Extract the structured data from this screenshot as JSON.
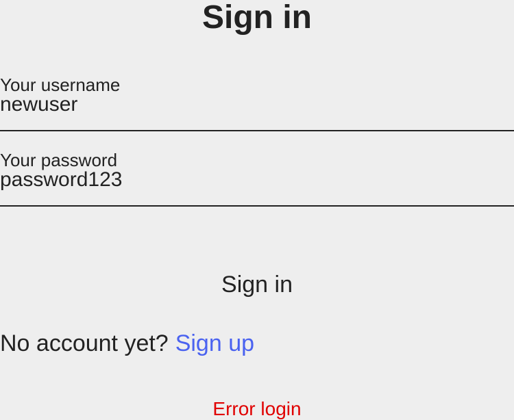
{
  "page": {
    "title": "Sign in"
  },
  "form": {
    "username": {
      "label": "Your username",
      "value": "newuser"
    },
    "password": {
      "label": "Your password",
      "value": "password123"
    },
    "submit_label": "Sign in"
  },
  "signup": {
    "prompt": "No account yet?",
    "link_label": "Sign up"
  },
  "status": {
    "error": "Error login"
  },
  "colors": {
    "background": "#eeeeee",
    "text": "#222222",
    "link": "#4a62f0",
    "error": "#e00000"
  }
}
